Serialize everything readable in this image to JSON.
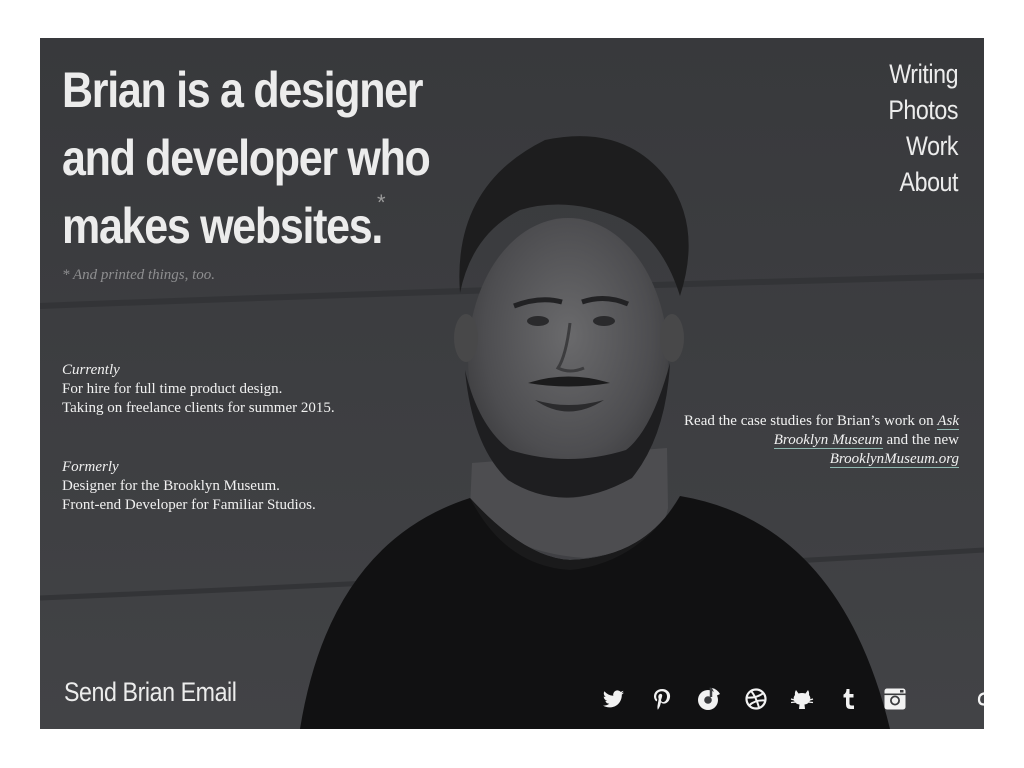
{
  "headline": {
    "lines": [
      "Brian is a designer",
      "and developer who",
      "makes websites."
    ],
    "asterisk": "*"
  },
  "footnote": "* And printed things, too.",
  "currently": {
    "label": "Currently",
    "lines": [
      "For hire for full time product design.",
      "Taking on freelance clients for summer 2015."
    ]
  },
  "formerly": {
    "label": "Formerly",
    "lines": [
      "Designer for the Brooklyn Museum.",
      "Front-end Developer for Familiar Studios."
    ]
  },
  "nav": {
    "items": [
      {
        "label": "Writing"
      },
      {
        "label": "Photos"
      },
      {
        "label": "Work"
      },
      {
        "label": "About"
      }
    ]
  },
  "case_studies": {
    "text_before": "Read the case studies for Brian’s work on",
    "link1": "Ask Brooklyn Museum",
    "text_middle": "and the new",
    "link2": "BrooklynMuseum.org"
  },
  "email_link": "Send Brian Email",
  "social": [
    {
      "icon": "twitter-icon"
    },
    {
      "icon": "pinterest-icon"
    },
    {
      "icon": "rdio-icon"
    },
    {
      "icon": "dribbble-icon"
    },
    {
      "icon": "github-icon"
    },
    {
      "icon": "tumblr-icon"
    },
    {
      "icon": "instagram-icon"
    },
    {
      "icon": "lastfm-icon"
    }
  ],
  "colors": {
    "background": "#3b3c3f",
    "text": "#ececec",
    "link_underline": "#8fb9b1",
    "footnote": "#8e8e90"
  }
}
